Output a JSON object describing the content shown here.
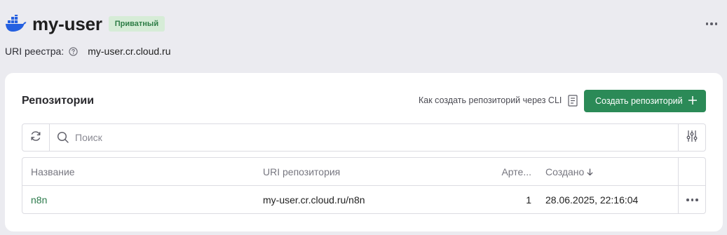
{
  "header": {
    "title": "my-user",
    "badge": "Приватный",
    "logo_icon": "docker-whale-icon",
    "more_icon": "more-horizontal-icon"
  },
  "registry": {
    "uri_label": "URI реестра:",
    "uri_value": "my-user.cr.cloud.ru",
    "help_icon": "help-circle-icon"
  },
  "repositories": {
    "title": "Репозитории",
    "cli_link": "Как создать репозиторий через CLI",
    "create_button": "Создать репозиторий",
    "search_placeholder": "Поиск",
    "columns": {
      "name": "Название",
      "uri": "URI репозитория",
      "artifacts": "Арте...",
      "created": "Создано"
    },
    "rows": [
      {
        "name": "n8n",
        "uri": "my-user.cr.cloud.ru/n8n",
        "artifacts": "1",
        "created": "28.06.2025, 22:16:04"
      }
    ]
  },
  "colors": {
    "accent": "#2b8a57",
    "badge_bg": "#d6ecd7",
    "badge_text": "#2e7d46",
    "logo_blue": "#2560e0",
    "page_bg": "#ebebf0"
  }
}
